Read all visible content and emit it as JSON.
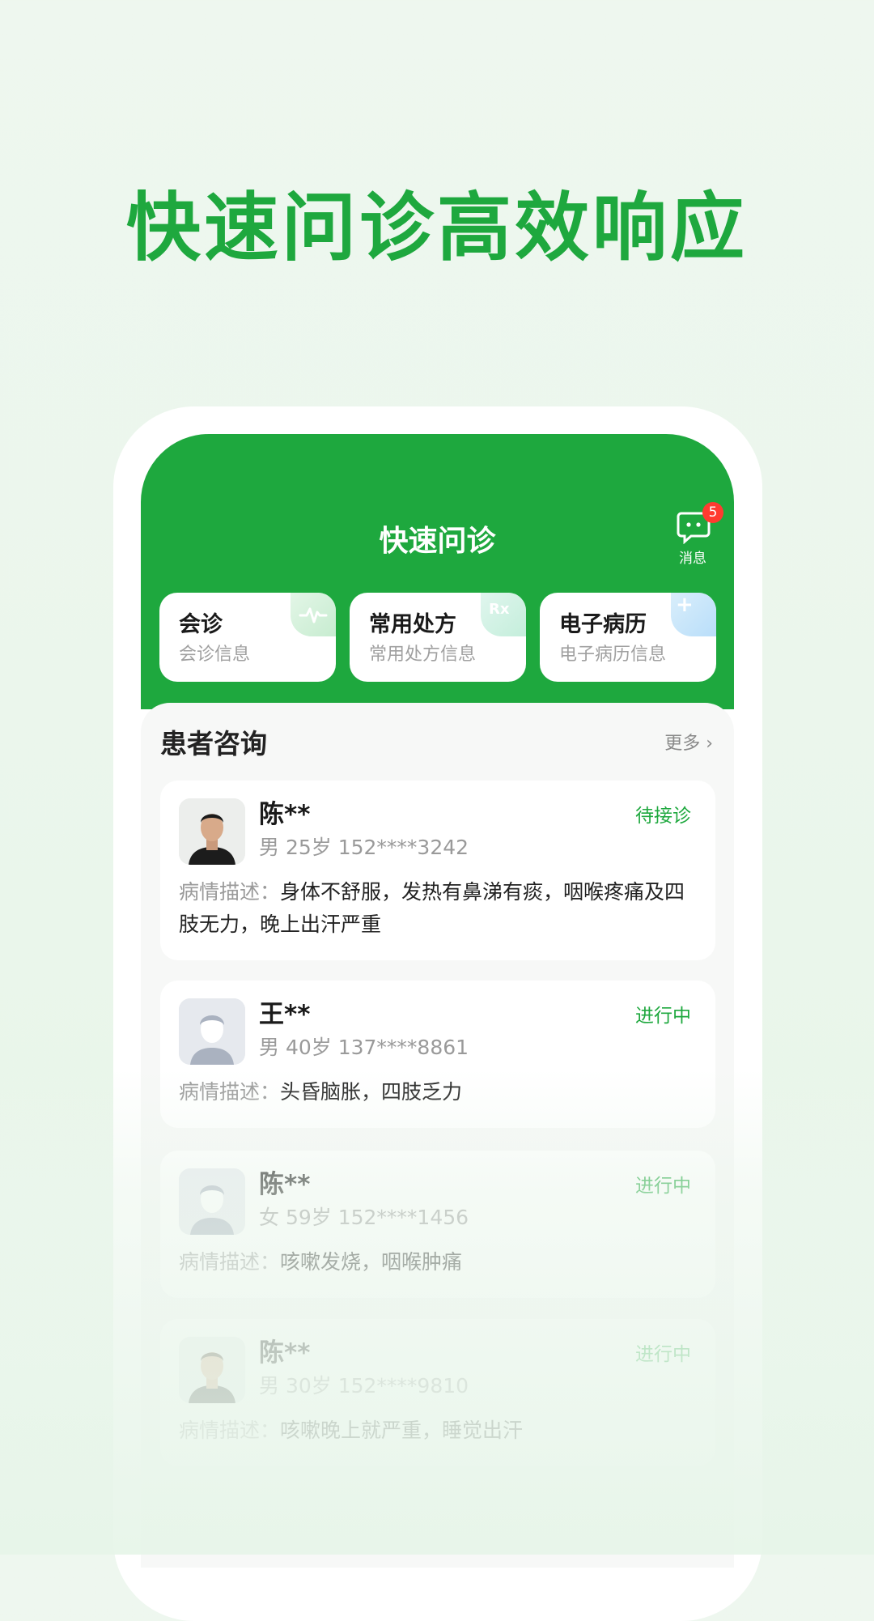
{
  "headline": "快速问诊高效响应",
  "app": {
    "title": "快速问诊",
    "messages": {
      "label": "消息",
      "badge": "5"
    }
  },
  "quick_actions": [
    {
      "title": "会诊",
      "subtitle": "会诊信息",
      "icon": "pulse-icon",
      "deco": ""
    },
    {
      "title": "常用处方",
      "subtitle": "常用处方信息",
      "icon": "rx-icon",
      "deco": "Rx"
    },
    {
      "title": "电子病历",
      "subtitle": "电子病历信息",
      "icon": "medical-cross-icon",
      "deco": "+"
    }
  ],
  "consultations": {
    "title": "患者咨询",
    "more": "更多 ›",
    "desc_label": "病情描述：",
    "patients": [
      {
        "name": "陈**",
        "info": "男 25岁 152****3242",
        "status": "待接诊",
        "desc": "身体不舒服，发热有鼻涕有痰，咽喉疼痛及四肢无力，晚上出汗严重",
        "avatar": "photo-avatar"
      },
      {
        "name": "王**",
        "info": "男 40岁 137****8861",
        "status": "进行中",
        "desc": "头昏脑胀，四肢乏力",
        "avatar": "default-avatar"
      },
      {
        "name": "陈**",
        "info": "女 59岁 152****1456",
        "status": "进行中",
        "desc": "咳嗽发烧，咽喉肿痛",
        "avatar": "default-avatar"
      },
      {
        "name": "陈**",
        "info": "男 30岁 152****9810",
        "status": "进行中",
        "desc": "咳嗽晚上就严重，睡觉出汗",
        "avatar": "photo-avatar"
      }
    ]
  },
  "colors": {
    "brand": "#1ea83e",
    "badge": "#ff3b30"
  }
}
